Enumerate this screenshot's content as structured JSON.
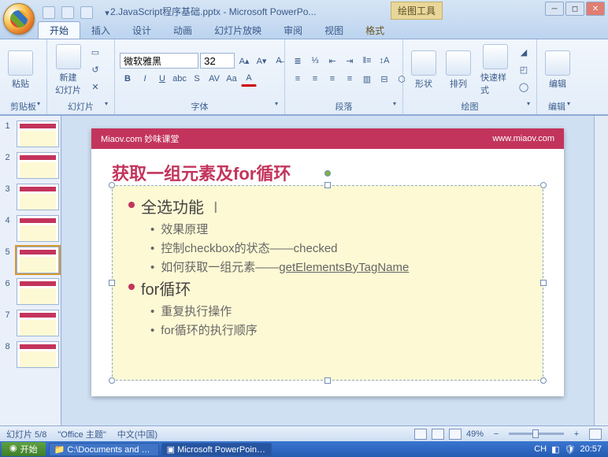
{
  "title": "2.JavaScript程序基础.pptx - Microsoft PowerPo...",
  "tools_tab": "绘图工具",
  "tabs": {
    "home": "开始",
    "insert": "插入",
    "design": "设计",
    "anim": "动画",
    "slideshow": "幻灯片放映",
    "review": "审阅",
    "view": "视图",
    "format": "格式"
  },
  "groups": {
    "clipboard": "剪贴板",
    "slides": "幻灯片",
    "font": "字体",
    "paragraph": "段落",
    "drawing": "绘图",
    "editing": "编辑"
  },
  "buttons": {
    "paste": "粘贴",
    "new_slide": "新建\n幻灯片",
    "shapes": "形状",
    "arrange": "排列",
    "quick_styles": "快速样式",
    "edit": "编辑"
  },
  "font": {
    "name": "微软雅黑",
    "size": "32"
  },
  "slide": {
    "brand": "Miaov.com 妙味课堂",
    "url": "www.miaov.com",
    "heading": "获取一组元素及for循环",
    "b1a": "全选功能",
    "b2a": "效果原理",
    "b2b": "控制checkbox的状态——checked",
    "b2c_pre": "如何获取一组元素——",
    "b2c_u": "getElementsByTagName",
    "b1b": "for循环",
    "b2d": "重复执行操作",
    "b2e": "for循环的执行顺序"
  },
  "status": {
    "slide": "幻灯片 5/8",
    "theme": "\"Office 主题\"",
    "lang": "中文(中国)",
    "zoom": "49%"
  },
  "totalSlides": 8,
  "selectedSlide": 5,
  "taskbar": {
    "start": "开始",
    "item1": "C:\\Documents and Settin...",
    "item2": "Microsoft PowerPoint - [...",
    "time": "20:57",
    "lang": "CH"
  }
}
